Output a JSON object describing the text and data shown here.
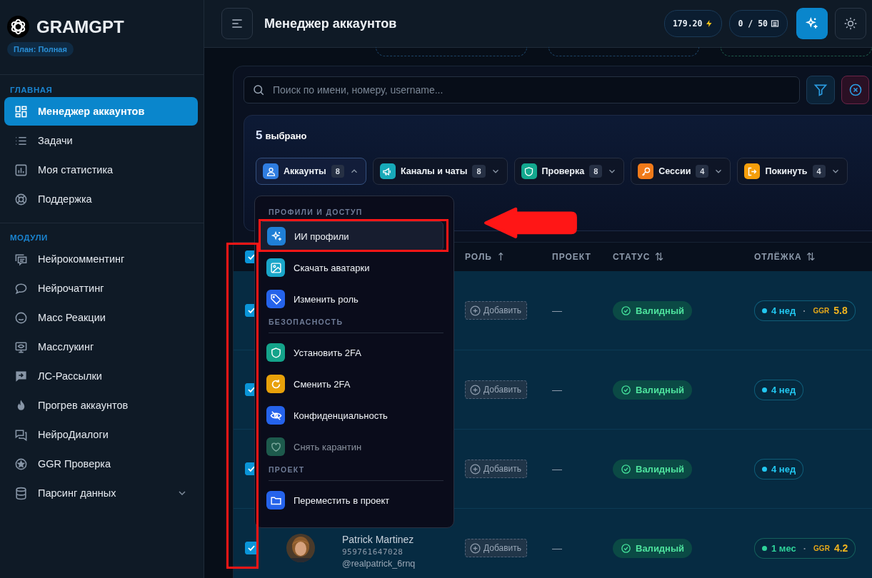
{
  "sidebar": {
    "logo": "GRAMGPT",
    "plan": "План: Полная",
    "sections": [
      {
        "title": "ГЛАВНАЯ",
        "items": [
          {
            "label": "Менеджер аккаунтов",
            "selected": true
          },
          {
            "label": "Задачи",
            "selected": false
          },
          {
            "label": "Моя статистика",
            "selected": false
          },
          {
            "label": "Поддержка",
            "selected": false
          }
        ]
      },
      {
        "title": "МОДУЛИ",
        "items": [
          {
            "label": "Нейрокомментинг",
            "selected": false
          },
          {
            "label": "Нейрочаттинг",
            "selected": false
          },
          {
            "label": "Масс Реакции",
            "selected": false
          },
          {
            "label": "Масслукинг",
            "selected": false
          },
          {
            "label": "ЛС-Рассылки",
            "selected": false
          },
          {
            "label": "Прогрев аккаунтов",
            "selected": false
          },
          {
            "label": "НейроДиалоги",
            "selected": false
          },
          {
            "label": "GGR Проверка",
            "selected": false
          },
          {
            "label": "Парсинг данных",
            "selected": false,
            "expanded": false
          }
        ]
      }
    ]
  },
  "header": {
    "title": "Менеджер аккаунтов",
    "balance": "179.20",
    "limit": "0 / 50"
  },
  "search": {
    "placeholder": "Поиск по имени, номеру, username..."
  },
  "selection": {
    "count": "5",
    "label": "выбрано"
  },
  "action_groups": [
    {
      "label": "Аккаунты",
      "count": "8",
      "expanded": true,
      "color": "#2f7de1"
    },
    {
      "label": "Каналы и чаты",
      "count": "8",
      "expanded": false,
      "color": "#17a9b8"
    },
    {
      "label": "Проверка",
      "count": "8",
      "expanded": false,
      "color": "#13a88f"
    },
    {
      "label": "Сессии",
      "count": "4",
      "expanded": false,
      "color": "#f07a1a"
    },
    {
      "label": "Покинуть",
      "count": "4",
      "expanded": false,
      "color": "#f59e0b"
    }
  ],
  "menu": {
    "sections": [
      {
        "title": "ПРОФИЛИ И ДОСТУП",
        "items": [
          {
            "label": "ИИ профили",
            "selected": true,
            "disabled": false,
            "color": "#1f7fd6"
          },
          {
            "label": "Скачать аватарки",
            "selected": false,
            "disabled": false,
            "color": "#1aa6c9"
          },
          {
            "label": "Изменить роль",
            "selected": false,
            "disabled": false,
            "color": "#2563eb"
          }
        ]
      },
      {
        "title": "БЕЗОПАСНОСТЬ",
        "items": [
          {
            "label": "Установить 2FA",
            "selected": false,
            "disabled": false,
            "color": "#14a38a"
          },
          {
            "label": "Сменить 2FA",
            "selected": false,
            "disabled": false,
            "color": "#e8a10a"
          },
          {
            "label": "Конфиденциальность",
            "selected": false,
            "disabled": false,
            "color": "#2563eb"
          },
          {
            "label": "Снять карантин",
            "selected": false,
            "disabled": true,
            "color": "#1d5a4c"
          }
        ]
      },
      {
        "title": "ПРОЕКТ",
        "items": [
          {
            "label": "Переместить в проект",
            "selected": false,
            "disabled": false,
            "color": "#2563eb"
          }
        ]
      }
    ]
  },
  "table": {
    "all_checked": true,
    "columns": [
      {
        "label": "РОЛЬ",
        "sort_mark": "↑"
      },
      {
        "label": "ПРОЕКТ"
      },
      {
        "label": "СТАТУС",
        "sort_mark": "⇅"
      },
      {
        "label": "ОТЛЁЖКА",
        "sort_mark": "⇅"
      }
    ],
    "rows": [
      {
        "checked": true,
        "role_button": "Добавить",
        "project": "—",
        "status": "Валидный",
        "age": "4 нед",
        "color": "#22c7f0",
        "separator": "·",
        "ggr_label": "GGR",
        "ggr": "5.8"
      },
      {
        "checked": true,
        "role_button": "Добавить",
        "project": "—",
        "status": "Валидный",
        "age": "4 нед",
        "color": "#22c7f0"
      },
      {
        "checked": true,
        "role_button": "Добавить",
        "project": "—",
        "status": "Валидный",
        "age": "4 нед",
        "color": "#22c7f0"
      },
      {
        "checked": true,
        "name": "Patrick Martinez",
        "phone": "959761647028",
        "username": "@realpatrick_6rnq",
        "role_button": "Добавить",
        "project": "—",
        "status": "Валидный",
        "age": "1 мес",
        "color": "#2fd39a",
        "separator": "·",
        "ggr_label": "GGR",
        "ggr": "4.2"
      }
    ]
  },
  "annotations": [
    {
      "kind": "frame"
    },
    {
      "kind": "frame"
    },
    {
      "kind": "arrow"
    }
  ]
}
